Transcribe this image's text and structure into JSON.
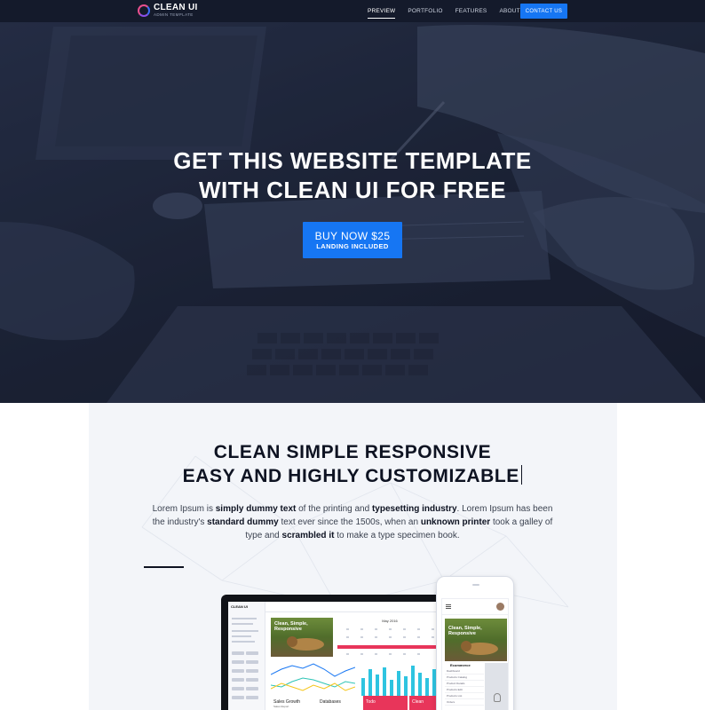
{
  "nav": {
    "logo_title": "CLEAN UI",
    "logo_subtitle": "ADMIN TEMPLATE",
    "links": [
      "PREVIEW",
      "PORTFOLIO",
      "FEATURES",
      "ABOUT US"
    ],
    "contact_label": "CONTACT US"
  },
  "hero": {
    "title_line1": "GET THIS WEBSITE TEMPLATE",
    "title_line2": "WITH CLEAN UI FOR FREE",
    "buy_label": "BUY NOW $25",
    "buy_sublabel": "LANDING INCLUDED"
  },
  "section2": {
    "title_line1": "CLEAN SIMPLE RESPONSIVE",
    "title_line2": "EASY AND HIGHLY CUSTOMIZABLE",
    "paragraph": [
      {
        "t": "Lorem Ipsum is ",
        "b": false
      },
      {
        "t": "simply dummy text",
        "b": true
      },
      {
        "t": " of the printing and ",
        "b": false
      },
      {
        "t": "typesetting industry",
        "b": true
      },
      {
        "t": ". Lorem Ipsum has been the industry's ",
        "b": false
      },
      {
        "t": "standard dummy",
        "b": true
      },
      {
        "t": " text ever since the 1500s, when an ",
        "b": false
      },
      {
        "t": "unknown printer",
        "b": true
      },
      {
        "t": " took a galley of type and ",
        "b": false
      },
      {
        "t": "scrambled it",
        "b": true
      },
      {
        "t": " to make a type specimen book.",
        "b": false
      }
    ]
  },
  "mockup": {
    "logo": "CLEAN UI",
    "photo_caption_line1": "Clean, Simple,",
    "photo_caption_line2": "Responsive",
    "calendar_month": "May 2016",
    "tiles": [
      {
        "label": "Sales Growth",
        "sub": "Sales Report",
        "color": "#ffffff",
        "text": "#222222"
      },
      {
        "label": "Databases",
        "sub": "",
        "color": "#ffffff",
        "text": "#222222"
      },
      {
        "label": "Todo",
        "sub": "",
        "color": "#e8355a",
        "text": "#ffffff"
      },
      {
        "label": "Clean",
        "sub": "",
        "color": "#e8355a",
        "text": "#ffffff"
      }
    ],
    "phone_menu_title": "Ecommerce",
    "phone_menu_items": [
      "Dashboard",
      "Products Catalog",
      "Product Details",
      "Products Edit",
      "Products List",
      "Orders"
    ]
  },
  "colors": {
    "accent": "#1676f3",
    "nav_bg": "#141a2b",
    "panel_bg": "#f3f5f9",
    "heading": "#0e1322",
    "mockup_red": "#e8355a"
  }
}
